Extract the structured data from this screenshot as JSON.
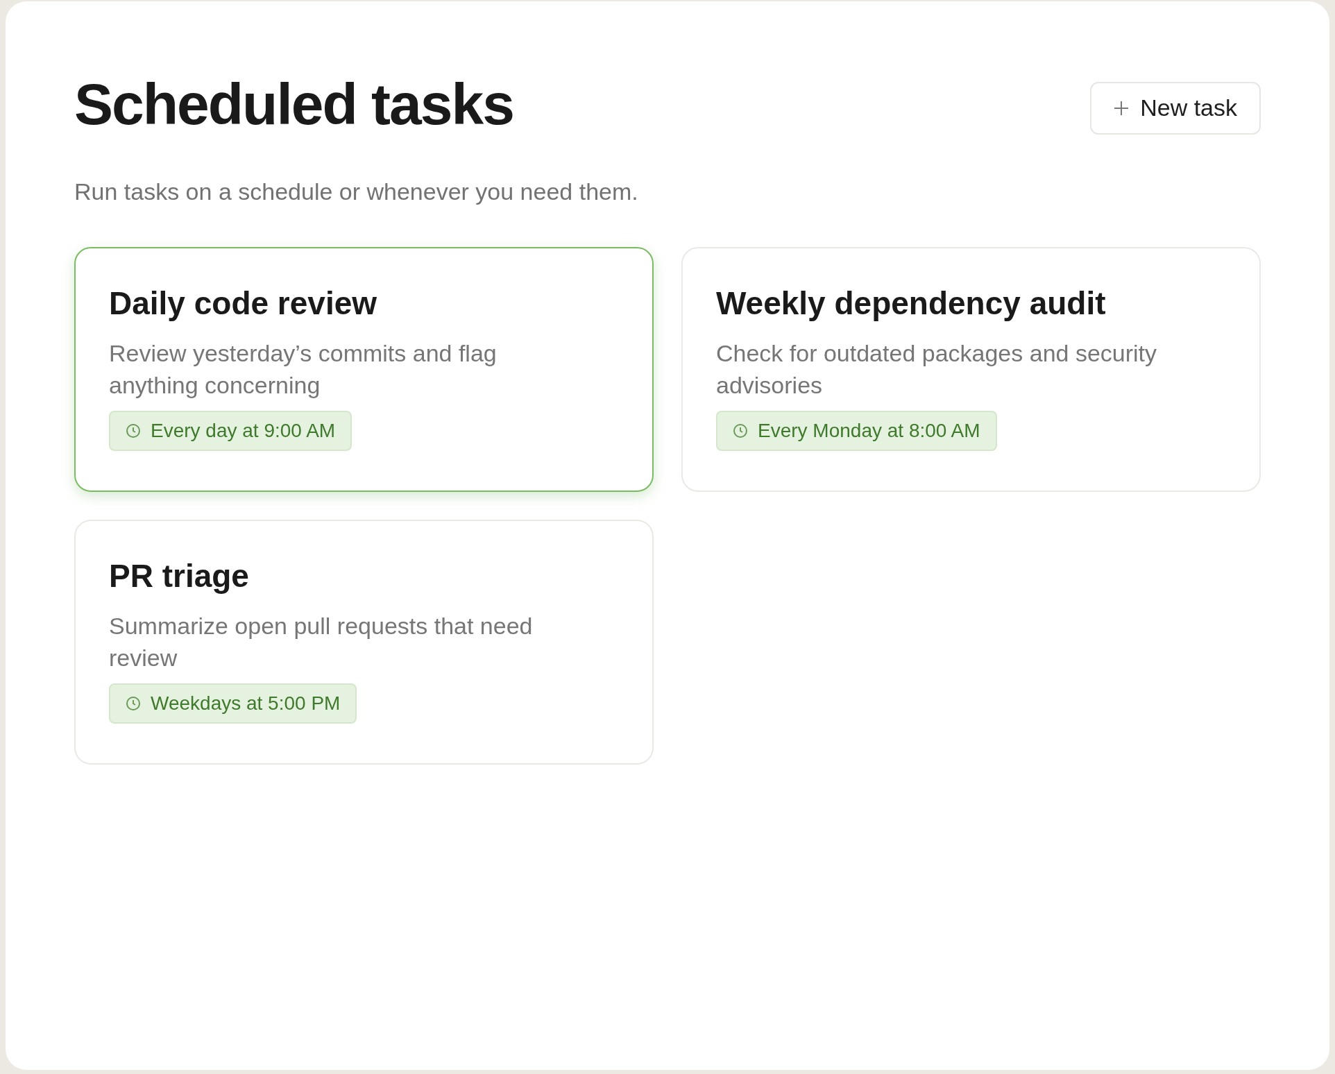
{
  "title": "Scheduled tasks",
  "new_task_button": {
    "label": "New task"
  },
  "subtitle": "Run tasks on a schedule or whenever you need them.",
  "tasks": [
    {
      "title": "Daily code review",
      "description": "Review yesterday’s commits and flag anything concerning",
      "schedule": "Every day at 9:00 AM",
      "selected": true
    },
    {
      "title": "Weekly dependency audit",
      "description": "Check for outdated packages and security advisories",
      "schedule": "Every Monday at 8:00 AM",
      "selected": false
    },
    {
      "title": "PR triage",
      "description": "Summarize open pull requests that need review",
      "schedule": "Weekdays at 5:00 PM",
      "selected": false
    }
  ]
}
